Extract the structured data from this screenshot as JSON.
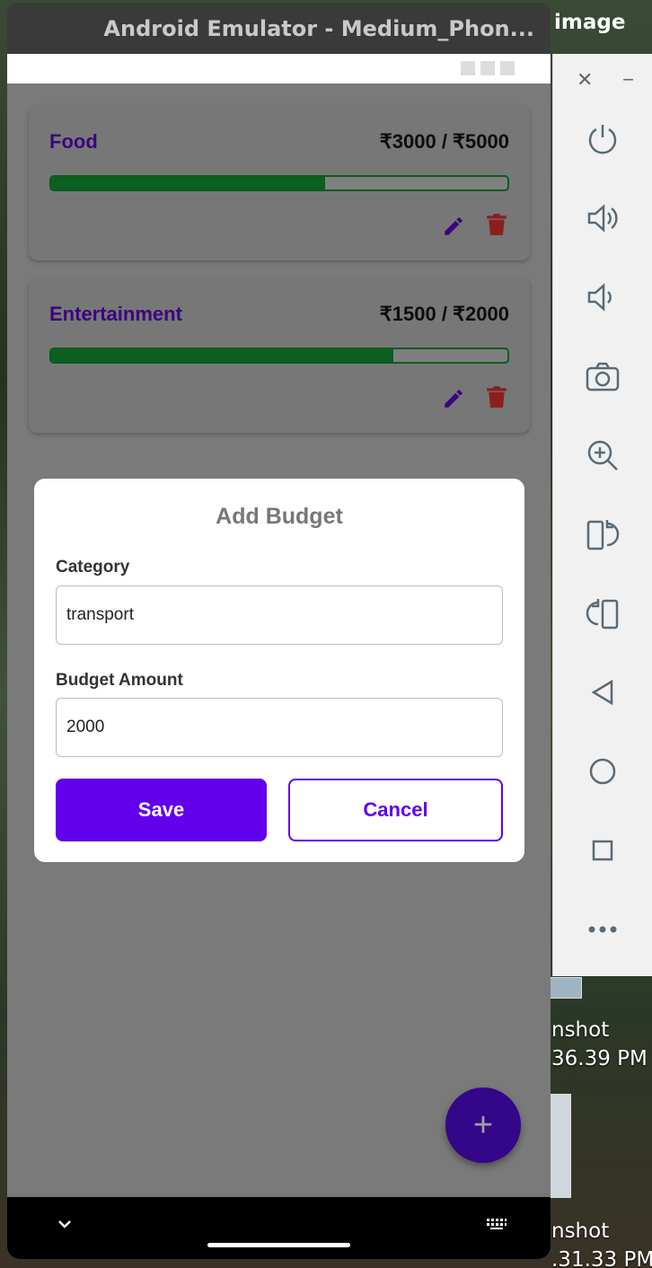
{
  "window": {
    "title": "Android Emulator - Medium_Phon...",
    "side_tab": "image"
  },
  "desktop": {
    "labels": [
      "nshot",
      "36.39 PM",
      "nshot",
      ".31.33 PM"
    ]
  },
  "budgets": [
    {
      "category": "Food",
      "amount_text": "₹3000 / ₹5000",
      "spent": 3000,
      "limit": 5000
    },
    {
      "category": "Entertainment",
      "amount_text": "₹1500 / ₹2000",
      "spent": 1500,
      "limit": 2000
    }
  ],
  "dialog": {
    "title": "Add Budget",
    "category_label": "Category",
    "category_value": "transport",
    "amount_label": "Budget Amount",
    "amount_value": "2000",
    "save_label": "Save",
    "cancel_label": "Cancel"
  },
  "fab": {
    "label": "+"
  },
  "colors": {
    "accent": "#6200ee",
    "category_text": "#3a0580",
    "progress": "#0b5f1f",
    "delete": "#8b1f1f"
  },
  "icons": {
    "toolbar": [
      "power-icon",
      "volume-up-icon",
      "volume-down-icon",
      "camera-icon",
      "zoom-in-icon",
      "rotate-left-icon",
      "rotate-right-icon",
      "back-icon",
      "home-icon",
      "overview-icon",
      "more-icon"
    ],
    "bottom_nav": [
      "dashboard-icon",
      "transactions-icon",
      "budget-icon",
      "profile-icon"
    ]
  }
}
